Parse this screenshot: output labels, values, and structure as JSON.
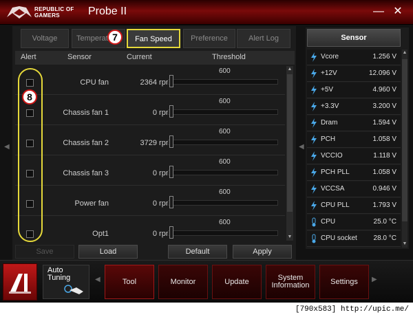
{
  "app": {
    "brand_line1": "REPUBLIC OF",
    "brand_line2": "GAMERS",
    "title": "Probe II",
    "minimize": "—",
    "close": "✕"
  },
  "tabs": [
    {
      "label": "Voltage",
      "active": false
    },
    {
      "label": "Temperat",
      "active": false
    },
    {
      "label": "Fan Speed",
      "active": true
    },
    {
      "label": "Preference",
      "active": false
    },
    {
      "label": "Alert Log",
      "active": false
    }
  ],
  "columns": {
    "alert": "Alert",
    "sensor": "Sensor",
    "current": "Current",
    "threshold": "Threshold"
  },
  "fan_rows": [
    {
      "sensor": "CPU fan",
      "current": "2364 rpm",
      "threshold": "600"
    },
    {
      "sensor": "Chassis fan 1",
      "current": "0 rpm",
      "threshold": "600"
    },
    {
      "sensor": "Chassis fan 2",
      "current": "3729 rpm",
      "threshold": "600"
    },
    {
      "sensor": "Chassis fan 3",
      "current": "0 rpm",
      "threshold": "600"
    },
    {
      "sensor": "Power fan",
      "current": "0 rpm",
      "threshold": "600"
    },
    {
      "sensor": "Opt1",
      "current": "0 rpm",
      "threshold": "600"
    }
  ],
  "buttons": {
    "save": "Save",
    "load": "Load",
    "default": "Default",
    "apply": "Apply"
  },
  "sensor_panel": {
    "title": "Sensor",
    "items": [
      {
        "name": "Vcore",
        "value": "1.256  V",
        "icon": "voltage-icon"
      },
      {
        "name": "+12V",
        "value": "12.096  V",
        "icon": "voltage-icon"
      },
      {
        "name": "+5V",
        "value": "4.960  V",
        "icon": "voltage-icon"
      },
      {
        "name": "+3.3V",
        "value": "3.200  V",
        "icon": "voltage-icon"
      },
      {
        "name": "Dram",
        "value": "1.594  V",
        "icon": "voltage-icon"
      },
      {
        "name": "PCH",
        "value": "1.058  V",
        "icon": "voltage-icon"
      },
      {
        "name": "VCCIO",
        "value": "1.118  V",
        "icon": "voltage-icon"
      },
      {
        "name": "PCH PLL",
        "value": "1.058  V",
        "icon": "voltage-icon"
      },
      {
        "name": "VCCSA",
        "value": "0.946  V",
        "icon": "voltage-icon"
      },
      {
        "name": "CPU PLL",
        "value": "1.793  V",
        "icon": "voltage-icon"
      },
      {
        "name": "CPU",
        "value": "25.0 °C",
        "icon": "thermometer-icon"
      },
      {
        "name": "CPU socket",
        "value": "28.0 °C",
        "icon": "thermometer-icon"
      }
    ]
  },
  "bottom_nav": {
    "auto_tuning_line1": "Auto",
    "auto_tuning_line2": "Tuning",
    "items": [
      {
        "label": "Tool",
        "active": true
      },
      {
        "label": "Monitor",
        "active": false
      },
      {
        "label": "Update",
        "active": false
      },
      {
        "label": "System Information",
        "active": false
      },
      {
        "label": "Settings",
        "active": false
      }
    ]
  },
  "callouts": {
    "c7": "7",
    "c8": "8"
  },
  "watermark": "[790x583] http://upic.me/",
  "colors": {
    "accent_red": "#a01818",
    "highlight_yellow": "#e6d93a",
    "sensor_icon": "#4aa8e8"
  }
}
